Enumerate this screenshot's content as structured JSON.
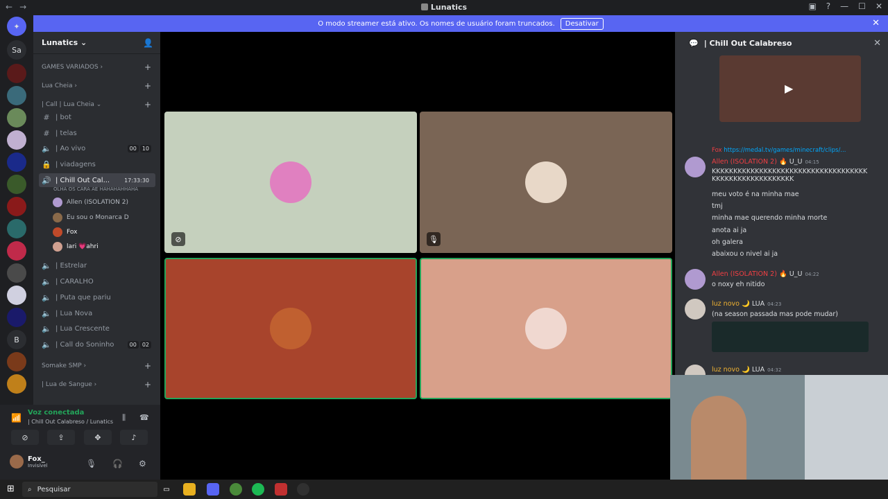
{
  "window": {
    "title": "Lunatics"
  },
  "banner": {
    "text": "O modo streamer está ativo. Os nomes de usuário foram truncados.",
    "button": "Desativar"
  },
  "guilds": [
    {
      "label": "Sa"
    },
    {
      "label": "B"
    }
  ],
  "server": {
    "name": "Lunatics ⌄"
  },
  "categories": [
    {
      "label": "GAMES VARIADOS ›"
    },
    {
      "label": "Lua Cheia ›"
    },
    {
      "label": "| Call | Lua Cheia ⌄"
    },
    {
      "label": "Somake SMP ›"
    },
    {
      "label": "| Lua de Sangue ›"
    }
  ],
  "channels": [
    {
      "label": "| bot"
    },
    {
      "label": "| telas"
    },
    {
      "label": "| Ao vivo",
      "c1": "00",
      "c2": "10"
    },
    {
      "label": "| viadagens"
    },
    {
      "label": "| Chill Out Cal...",
      "time": "17:33:30"
    },
    {
      "label": "| Estrelar"
    },
    {
      "label": "| CARALHO"
    },
    {
      "label": "| Puta que pariu"
    },
    {
      "label": "| Lua Nova"
    },
    {
      "label": "| Lua Crescente"
    },
    {
      "label": "| Call do Soninho",
      "c1": "00",
      "c2": "02"
    }
  ],
  "channel_status": "OLHA OS CARA AE HAHAHAHHAHA",
  "members": [
    {
      "name": "Allen (ISOLATION 2)"
    },
    {
      "name": "Eu sou o Monarca D"
    },
    {
      "name": "Fox"
    },
    {
      "name": "lari 💗ahri"
    }
  ],
  "voice": {
    "status": "Voz conectada",
    "location": "| Chill Out Calabreso / Lunatics"
  },
  "user": {
    "name": "Fox_",
    "status": "Invisível"
  },
  "chat": {
    "title": "| Chill Out Calabreso",
    "messages": [
      {
        "reply": "Fox",
        "link": "https://medal.tv/games/minecraft/clips/..."
      },
      {
        "author": "Allen (ISOLATION 2)",
        "tags": "🔥 U_U",
        "time": "04:15",
        "text": "KKKKKKKKKKKKKKKKKKKKKKKKKKKKKKKKKKKKKKKKKKKKKKKKKKKKKKK"
      },
      {
        "text": "meu voto é na minha mae"
      },
      {
        "text": "tmj"
      },
      {
        "text": "minha mae querendo minha morte"
      },
      {
        "text": "anota ai ja"
      },
      {
        "text": "oh galera"
      },
      {
        "text": "abaixou o nivel ai ja"
      },
      {
        "author": "Allen (ISOLATION 2)",
        "tags": "🔥 U_U",
        "time": "04:22",
        "text": "o noxy eh nitido"
      },
      {
        "author": "luz novo",
        "tags": "🌙 LUA",
        "time": "04:23",
        "text": "(na season passada mas pode mudar)"
      },
      {
        "author": "luz novo",
        "tags": "🌙 LUA",
        "time": "04:32"
      }
    ]
  },
  "taskbar": {
    "search": "Pesquisar"
  },
  "colors": {
    "accent": "#5865f2",
    "speaking": "#23a55a",
    "danger": "#f23f43"
  }
}
